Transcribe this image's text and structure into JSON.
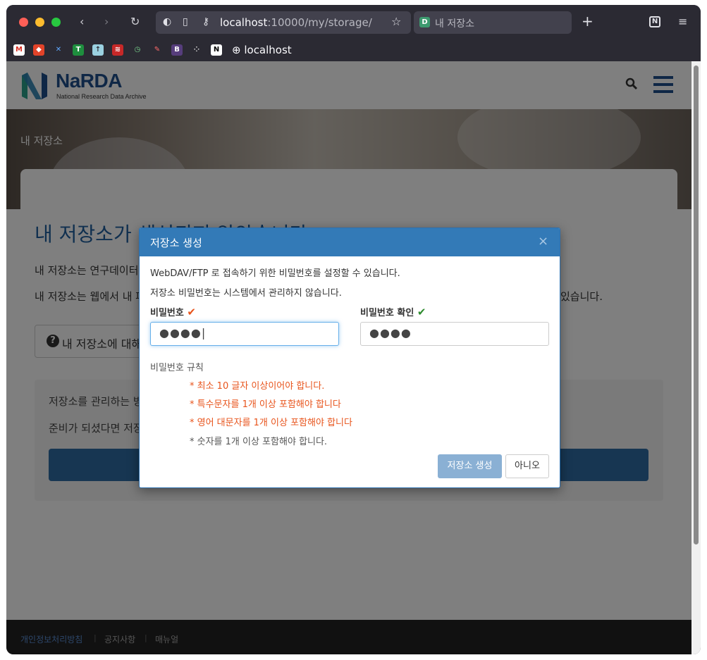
{
  "browser": {
    "url_host": "localhost",
    "url_path": ":10000/my/storage/",
    "tab_title": "내 저장소",
    "bookmark_label": "localhost"
  },
  "site": {
    "logo_title": "NaRDA",
    "logo_subtitle": "National Research Data Archive",
    "hero_title": "내 저장소"
  },
  "main": {
    "heading": "내 저장소가 생성되지 않았습니다",
    "para1": "내 저장소는 연구데이터",
    "para2": "내 저장소는 웹에서 내 파",
    "para2_tail": "있습니다.",
    "help_button": "내 저장소에 대해",
    "box_line1": "저장소를 관리하는 방",
    "box_line2": "준비가 되셨다면 저장"
  },
  "footer": {
    "links": [
      "개인정보처리방침",
      "공지사항",
      "매뉴얼"
    ]
  },
  "modal": {
    "title": "저장소 생성",
    "close": "×",
    "line1": "WebDAV/FTP 로 접속하기 위한 비밀번호를 설정할 수 있습니다.",
    "line2": "저장소 비밀번호는 시스템에서 관리하지 않습니다.",
    "password_label": "비밀번호",
    "password_check": "✔",
    "password_value": "●●●●|",
    "confirm_label": "비밀번호 확인",
    "confirm_check": "✔",
    "confirm_value": "●●●●",
    "rules_heading": "비밀번호 규칙",
    "rules": [
      "* 최소 10 글자 이상이어야 합니다.",
      "* 특수문자를 1개 이상 포함해야 합니다",
      "* 영어 대문자를 1개 이상 포함해야 합니다",
      "* 숫자를 1개 이상 포함해야 합니다."
    ],
    "create_button": "저장소 생성",
    "cancel_button": "아니오"
  },
  "colors": {
    "brand": "#1f4e8c",
    "modal_header": "#337ab7",
    "rule_fail": "#e8541c",
    "rule_pass": "#555555",
    "check_ok": "#2e8b2e"
  }
}
